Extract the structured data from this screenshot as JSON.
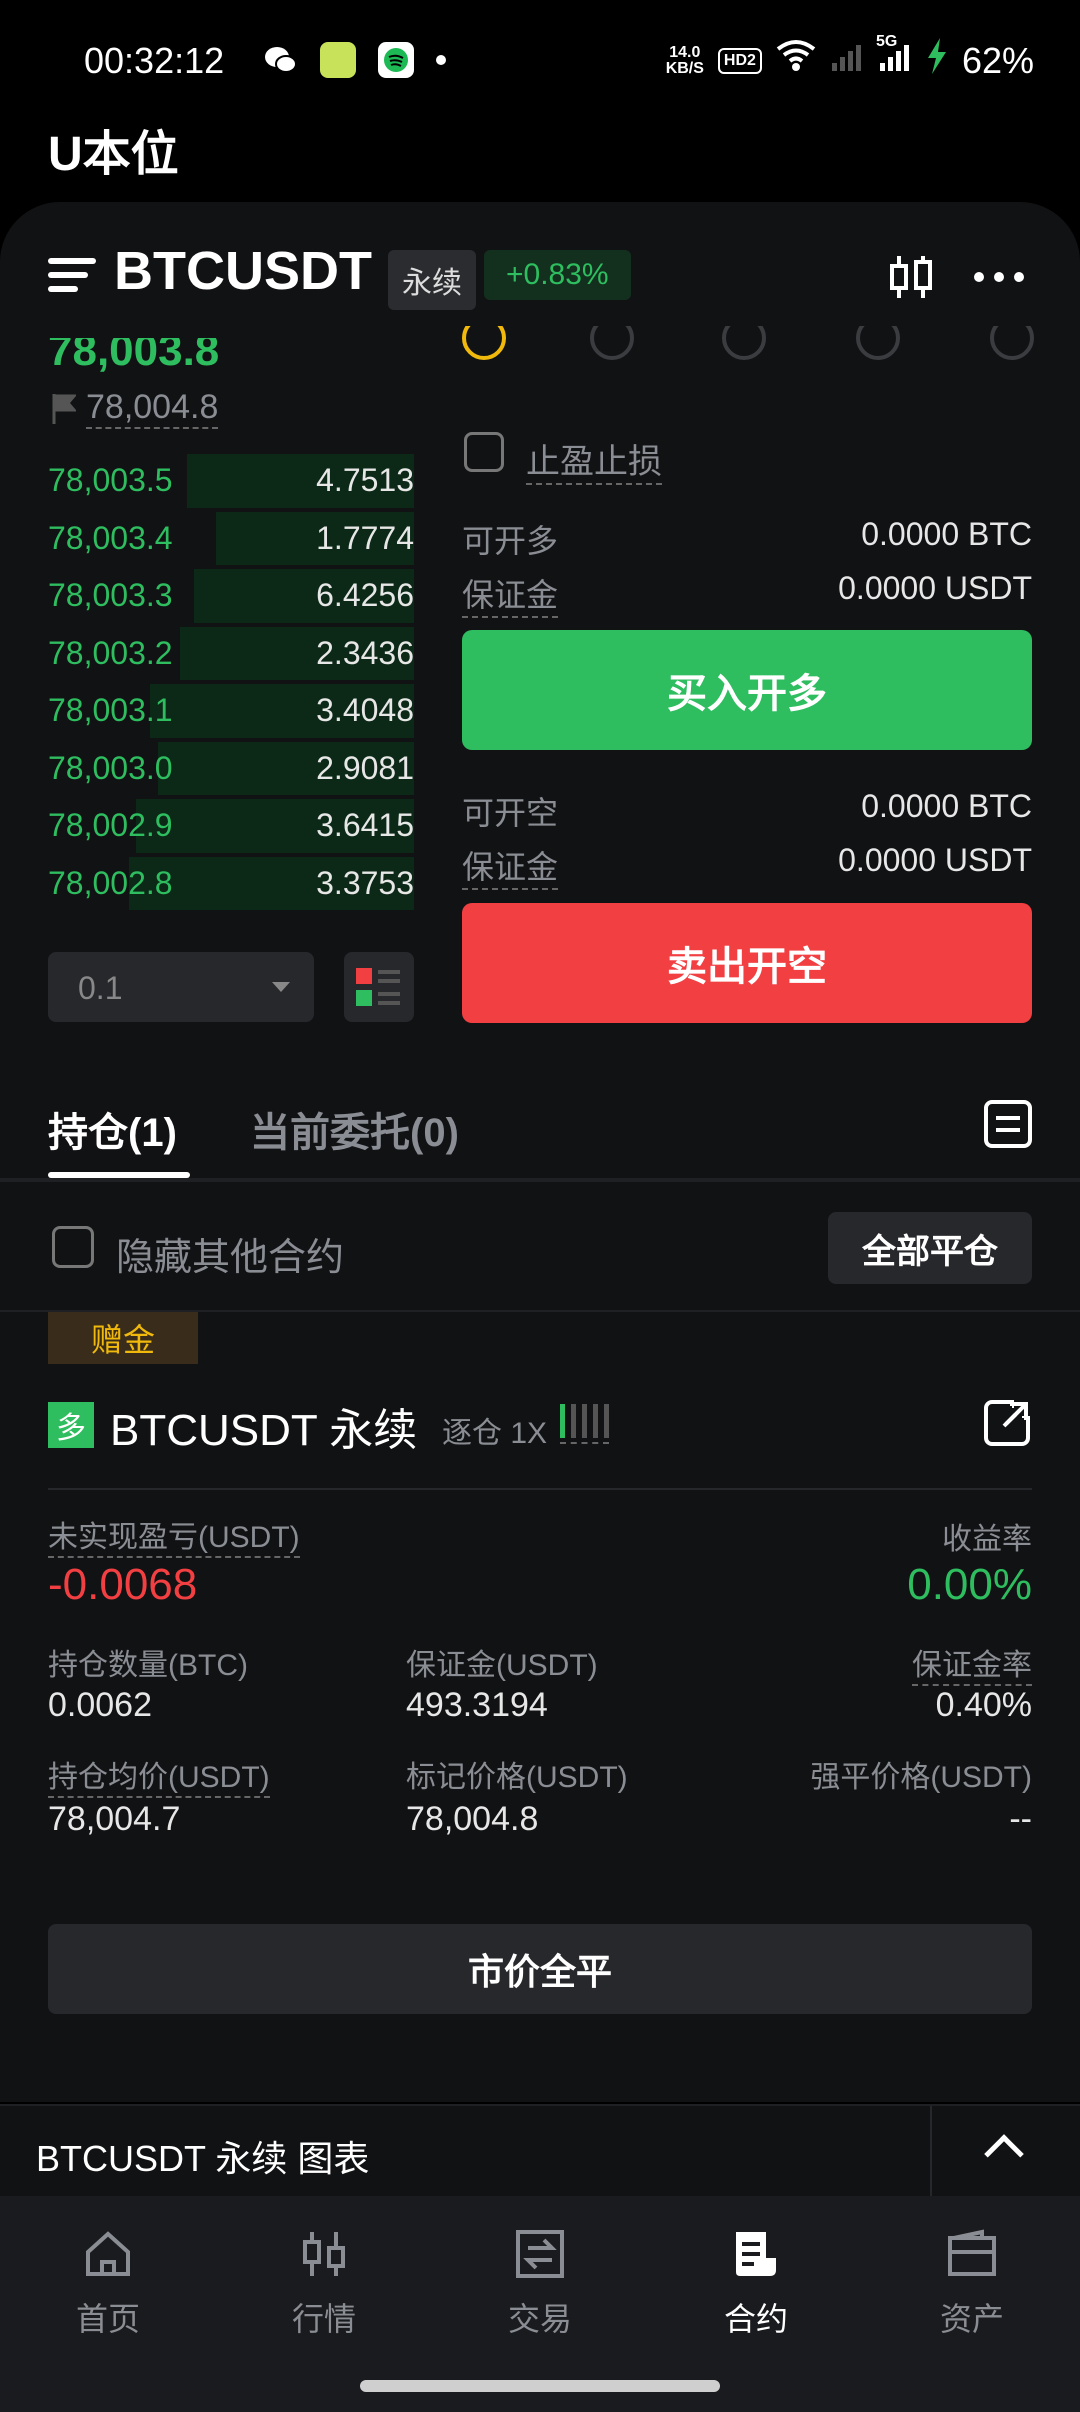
{
  "status_bar": {
    "time": "00:32:12",
    "net_speed_value": "14.0",
    "net_speed_unit": "KB/S",
    "hd_label": "HD2",
    "signal_label": "5G",
    "battery": "62%"
  },
  "page_title": "U本位",
  "header": {
    "symbol": "BTCUSDT",
    "contract_type": "永续",
    "change": "+0.83%"
  },
  "prices": {
    "last_price": "78,003.8",
    "mark_price": "78,004.8"
  },
  "order_book": [
    {
      "price": "78,003.5",
      "qty": "4.7513",
      "depth": 0.62
    },
    {
      "price": "78,003.4",
      "qty": "1.7774",
      "depth": 0.54
    },
    {
      "price": "78,003.3",
      "qty": "6.4256",
      "depth": 0.6
    },
    {
      "price": "78,003.2",
      "qty": "2.3436",
      "depth": 0.64
    },
    {
      "price": "78,003.1",
      "qty": "3.4048",
      "depth": 0.72
    },
    {
      "price": "78,003.0",
      "qty": "2.9081",
      "depth": 0.7
    },
    {
      "price": "78,002.9",
      "qty": "3.6415",
      "depth": 0.76
    },
    {
      "price": "78,002.8",
      "qty": "3.3753",
      "depth": 0.78
    }
  ],
  "precision_select": "0.1",
  "tpsl_label": "止盈止损",
  "long_section": {
    "can_open_label": "可开多",
    "can_open_value": "0.0000 BTC",
    "margin_label": "保证金",
    "margin_value": "0.0000 USDT",
    "button": "买入开多"
  },
  "short_section": {
    "can_open_label": "可开空",
    "can_open_value": "0.0000 BTC",
    "margin_label": "保证金",
    "margin_value": "0.0000 USDT",
    "button": "卖出开空"
  },
  "tabs": {
    "positions": "持仓(1)",
    "open_orders": "当前委托(0)"
  },
  "hide_other_label": "隐藏其他合约",
  "close_all_button": "全部平仓",
  "position": {
    "bonus_tag": "赠金",
    "side_badge": "多",
    "symbol": "BTCUSDT 永续",
    "margin_mode": "逐仓 1X",
    "leverage_level": 0.2,
    "unrealized_pnl_label": "未实现盈亏(USDT)",
    "unrealized_pnl_value": "-0.0068",
    "roe_label": "收益率",
    "roe_value": "0.00%",
    "size_label": "持仓数量(BTC)",
    "size_value": "0.0062",
    "margin_label": "保证金(USDT)",
    "margin_value": "493.3194",
    "margin_ratio_label": "保证金率",
    "margin_ratio_value": "0.40%",
    "entry_label": "持仓均价(USDT)",
    "entry_value": "78,004.7",
    "mark_label": "标记价格(USDT)",
    "mark_value": "78,004.8",
    "liq_label": "强平价格(USDT)",
    "liq_value": "--",
    "market_close_button": "市价全平"
  },
  "chart_bar_title": "BTCUSDT 永续 图表",
  "nav": [
    {
      "label": "首页",
      "icon": "home-icon"
    },
    {
      "label": "行情",
      "icon": "market-icon"
    },
    {
      "label": "交易",
      "icon": "trade-icon"
    },
    {
      "label": "合约",
      "icon": "futures-icon"
    },
    {
      "label": "资产",
      "icon": "wallet-icon"
    }
  ],
  "colors": {
    "green": "#2ebd5f",
    "red": "#f23f42",
    "gold": "#f0b90b"
  }
}
